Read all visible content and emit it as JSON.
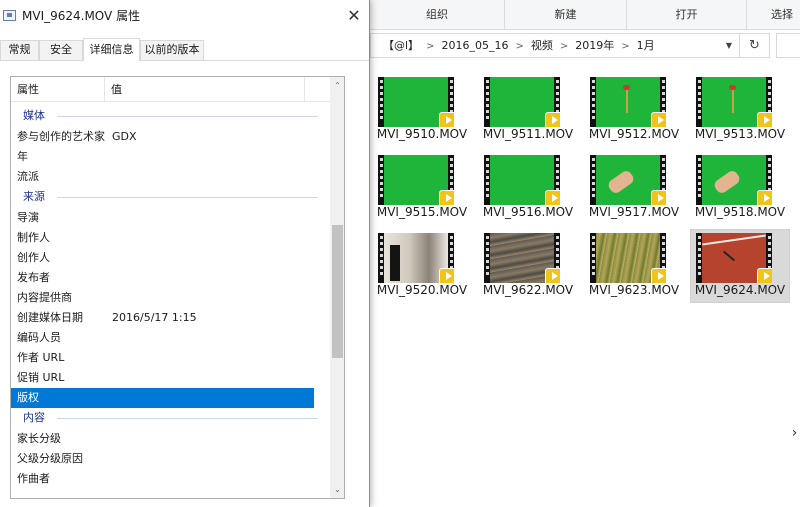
{
  "explorer": {
    "ribbon": [
      "组织",
      "新建",
      "打开",
      "选择"
    ],
    "breadcrumb": [
      "【@l】",
      "2016_05_16",
      "视频",
      "2019年",
      "1月"
    ],
    "files": [
      {
        "name": "MVI_9510.MOV",
        "thumb": "green-screen"
      },
      {
        "name": "MVI_9511.MOV",
        "thumb": "green-screen"
      },
      {
        "name": "MVI_9512.MOV",
        "thumb": "green-screen-flower"
      },
      {
        "name": "MVI_9513.MOV",
        "thumb": "green-screen-flower"
      },
      {
        "name": "MVI_9515.MOV",
        "thumb": "green-screen"
      },
      {
        "name": "MVI_9516.MOV",
        "thumb": "green-screen"
      },
      {
        "name": "MVI_9517.MOV",
        "thumb": "green-screen-hand"
      },
      {
        "name": "MVI_9518.MOV",
        "thumb": "green-screen-hand"
      },
      {
        "name": "MVI_9520.MOV",
        "thumb": "corridor"
      },
      {
        "name": "MVI_9622.MOV",
        "thumb": "water"
      },
      {
        "name": "MVI_9623.MOV",
        "thumb": "grass"
      },
      {
        "name": "MVI_9624.MOV",
        "thumb": "track",
        "selected": true
      }
    ]
  },
  "dialog": {
    "title": "MVI_9624.MOV 属性",
    "tabs": [
      "常规",
      "安全",
      "详细信息",
      "以前的版本"
    ],
    "active_tab": "详细信息",
    "columns": {
      "property": "属性",
      "value": "值"
    },
    "rows": [
      {
        "type": "group",
        "label": "媒体"
      },
      {
        "type": "item",
        "key": "参与创作的艺术家",
        "value": "GDX"
      },
      {
        "type": "item",
        "key": "年",
        "value": ""
      },
      {
        "type": "item",
        "key": "流派",
        "value": ""
      },
      {
        "type": "group",
        "label": "来源"
      },
      {
        "type": "item",
        "key": "导演",
        "value": ""
      },
      {
        "type": "item",
        "key": "制作人",
        "value": ""
      },
      {
        "type": "item",
        "key": "创作人",
        "value": ""
      },
      {
        "type": "item",
        "key": "发布者",
        "value": ""
      },
      {
        "type": "item",
        "key": "内容提供商",
        "value": ""
      },
      {
        "type": "item",
        "key": "创建媒体日期",
        "value": "2016/5/17 1:15"
      },
      {
        "type": "item",
        "key": "编码人员",
        "value": ""
      },
      {
        "type": "item",
        "key": "作者 URL",
        "value": ""
      },
      {
        "type": "item",
        "key": "促销 URL",
        "value": ""
      },
      {
        "type": "item",
        "key": "版权",
        "value": "",
        "selected": true
      },
      {
        "type": "group",
        "label": "内容"
      },
      {
        "type": "item",
        "key": "家长分级",
        "value": ""
      },
      {
        "type": "item",
        "key": "父级分级原因",
        "value": ""
      },
      {
        "type": "item",
        "key": "作曲者",
        "value": ""
      }
    ]
  },
  "colors": {
    "selection_blue": "#0078d7",
    "group_header": "#1e3287",
    "green_screen": "#1fb53a",
    "badge_yellow": "#f0c419"
  }
}
